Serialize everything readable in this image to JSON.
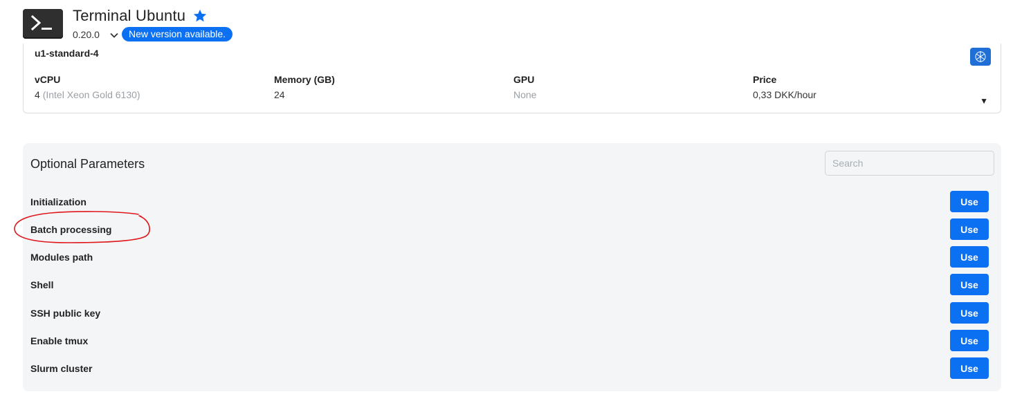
{
  "app": {
    "title": "Terminal Ubuntu",
    "version": "0.20.0",
    "badge": "New version available.",
    "icon": "terminal-prompt-icon",
    "star_color": "#0c70f2"
  },
  "machine": {
    "name": "u1-standard-4",
    "specs": [
      {
        "label": "vCPU",
        "value": "4",
        "detail": "(Intel Xeon Gold 6130)"
      },
      {
        "label": "Memory (GB)",
        "value": "24",
        "detail": ""
      },
      {
        "label": "GPU",
        "value": "None",
        "detail": ""
      },
      {
        "label": "Price",
        "value": "0,33 DKK/hour",
        "detail": ""
      }
    ],
    "dropdown_arrow": "▼"
  },
  "optional_parameters": {
    "title": "Optional Parameters",
    "search_placeholder": "Search",
    "button_label": "Use",
    "items": [
      {
        "label": "Initialization"
      },
      {
        "label": "Batch processing"
      },
      {
        "label": "Modules path"
      },
      {
        "label": "Shell"
      },
      {
        "label": "SSH public key"
      },
      {
        "label": "Enable tmux"
      },
      {
        "label": "Slurm cluster"
      }
    ]
  },
  "colors": {
    "accent": "#0c70f2",
    "annotation": "#e0161b",
    "panel_bg": "#f4f5f7"
  }
}
